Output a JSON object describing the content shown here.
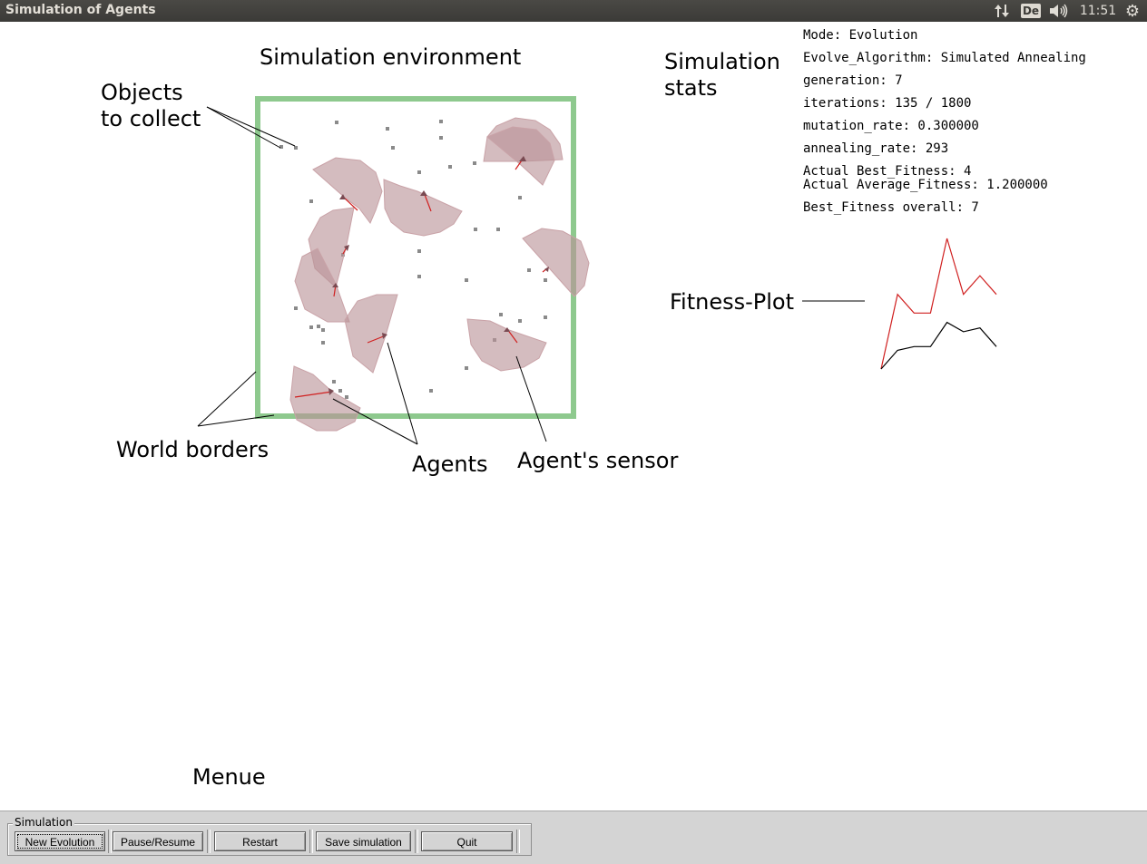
{
  "window": {
    "title": "Simulation of Agents"
  },
  "tray": {
    "network_icon": "up-down-arrows",
    "keyboard_layout": "De",
    "volume_icon": "speaker",
    "clock": "11:51",
    "settings_icon": "gear"
  },
  "annotations": {
    "sim_environment": "Simulation environment",
    "objects_line1": "Objects",
    "objects_line2": "to collect",
    "sim_stats_line1": "Simulation",
    "sim_stats_line2": "stats",
    "fitness_plot": "Fitness-Plot",
    "world_borders": "World borders",
    "agents": "Agents",
    "agent_sensor": "Agent's sensor",
    "menue": "Menue"
  },
  "stats": {
    "mode": "Mode: Evolution",
    "algorithm": "Evolve_Algorithm: Simulated Annealing",
    "generation": "generation: 7",
    "iterations": "iterations: 135 / 1800",
    "mutation_rate": "mutation_rate: 0.300000",
    "annealing_rate": "annealing_rate: 293",
    "actual_best": "Actual Best_Fitness: 4",
    "actual_avg": "Actual Average_Fitness: 1.200000",
    "best_overall": "Best_Fitness overall: 7"
  },
  "menu": {
    "group_label": "Simulation",
    "buttons": [
      "New Evolution",
      "Pause/Resume",
      "Restart",
      "Save simulation",
      "Quit"
    ]
  },
  "colors": {
    "border": "#8ec98e",
    "sensor_fill": "#c9a8ab",
    "agent_line": "#d02020",
    "best_fitness_line": "#d02020",
    "avg_fitness_line": "#000000"
  },
  "chart_data": {
    "type": "line",
    "title": "",
    "xlabel": "",
    "ylabel": "",
    "x": [
      0,
      1,
      2,
      3,
      4,
      5,
      6,
      7
    ],
    "series": [
      {
        "values": [
          0,
          4,
          3,
          3,
          7,
          4,
          5,
          4
        ]
      },
      {
        "values": [
          0,
          1,
          1.2,
          1.2,
          2.5,
          2,
          2.2,
          1.2
        ]
      }
    ],
    "ylim": [
      0,
      7
    ],
    "grid": false
  }
}
